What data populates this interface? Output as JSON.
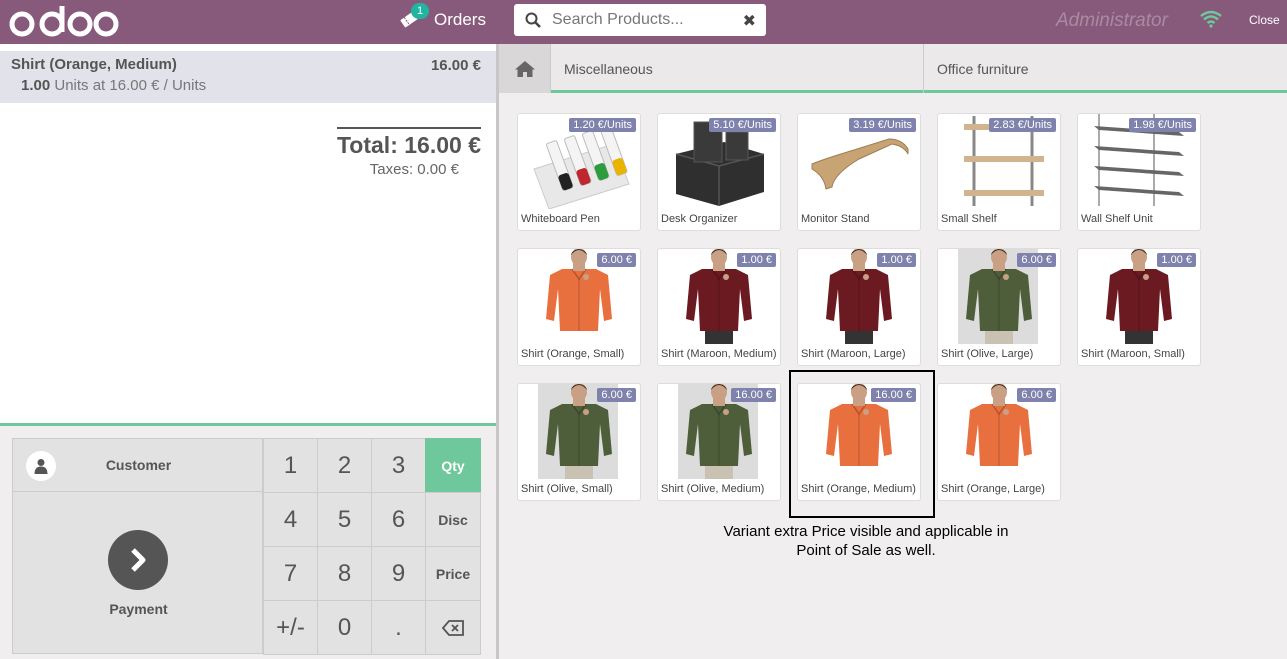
{
  "header": {
    "logo_text": "odoo",
    "orders_label": "Orders",
    "orders_count": "1",
    "search_placeholder": "Search Products...",
    "user": "Administrator",
    "close_label": "Close"
  },
  "order": {
    "line": {
      "name": "Shirt (Orange, Medium)",
      "price": "16.00 €",
      "qty": "1.00",
      "unit_text": "Units at 16.00 € / Units"
    },
    "total": "Total: 16.00 €",
    "taxes": "Taxes: 0.00 €"
  },
  "controls": {
    "customer_label": "Customer",
    "payment_label": "Payment",
    "keys": [
      {
        "label": "1",
        "type": "digit"
      },
      {
        "label": "2",
        "type": "digit"
      },
      {
        "label": "3",
        "type": "digit"
      },
      {
        "label": "Qty",
        "type": "mode",
        "active": true
      },
      {
        "label": "4",
        "type": "digit"
      },
      {
        "label": "5",
        "type": "digit"
      },
      {
        "label": "6",
        "type": "digit"
      },
      {
        "label": "Disc",
        "type": "mode"
      },
      {
        "label": "7",
        "type": "digit"
      },
      {
        "label": "8",
        "type": "digit"
      },
      {
        "label": "9",
        "type": "digit"
      },
      {
        "label": "Price",
        "type": "mode"
      },
      {
        "label": "+/-",
        "type": "digit"
      },
      {
        "label": "0",
        "type": "digit"
      },
      {
        "label": ".",
        "type": "digit"
      },
      {
        "label": "",
        "type": "backspace"
      }
    ]
  },
  "categories": [
    "Miscellaneous",
    "Office furniture"
  ],
  "products": [
    {
      "name": "Whiteboard Pen",
      "price": "1.20 €/Units",
      "icon": "pens"
    },
    {
      "name": "Desk Organizer",
      "price": "5.10 €/Units",
      "icon": "organizer"
    },
    {
      "name": "Monitor Stand",
      "price": "3.19 €/Units",
      "icon": "stand"
    },
    {
      "name": "Small Shelf",
      "price": "2.83 €/Units",
      "icon": "shelf"
    },
    {
      "name": "Wall Shelf Unit",
      "price": "1.98 €/Units",
      "icon": "wallshelf"
    },
    {
      "name": "Shirt (Orange, Small)",
      "price": "6.00 €",
      "icon": "shirt",
      "color": "#e8703f",
      "pants": "#ffffff"
    },
    {
      "name": "Shirt (Maroon, Medium)",
      "price": "1.00 €",
      "icon": "shirt",
      "color": "#6b1a22",
      "pants": "#333333"
    },
    {
      "name": "Shirt (Maroon, Large)",
      "price": "1.00 €",
      "icon": "shirt",
      "color": "#6b1a22",
      "pants": "#333333"
    },
    {
      "name": "Shirt (Olive, Large)",
      "price": "6.00 €",
      "icon": "shirt",
      "color": "#4e5e3a",
      "pants": "#c9c2b2",
      "bg": "#dcdcdc"
    },
    {
      "name": "Shirt (Maroon, Small)",
      "price": "1.00 €",
      "icon": "shirt",
      "color": "#6b1a22",
      "pants": "#333333"
    },
    {
      "name": "Shirt (Olive, Small)",
      "price": "6.00 €",
      "icon": "shirt",
      "color": "#4e5e3a",
      "pants": "#c9c2b2",
      "bg": "#dcdcdc"
    },
    {
      "name": "Shirt (Olive, Medium)",
      "price": "16.00 €",
      "icon": "shirt",
      "color": "#4e5e3a",
      "pants": "#c9c2b2",
      "bg": "#dcdcdc"
    },
    {
      "name": "Shirt (Orange, Medium)",
      "price": "16.00 €",
      "icon": "shirt",
      "color": "#e8703f",
      "pants": "#ffffff"
    },
    {
      "name": "Shirt (Orange, Large)",
      "price": "6.00 €",
      "icon": "shirt",
      "color": "#e8703f",
      "pants": "#ffffff"
    }
  ],
  "annotation": "Variant extra Price visible and applicable in Point of Sale as well.",
  "colors": {
    "brand": "#875a7b",
    "accent": "#6ec89b",
    "price_tag": "#7f82ac"
  }
}
